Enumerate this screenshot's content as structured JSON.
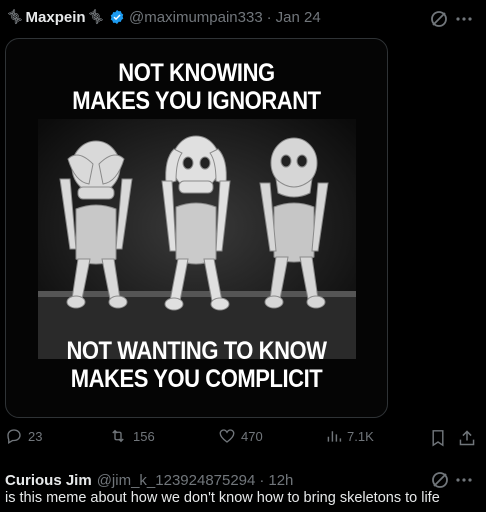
{
  "tweet": {
    "display_name": "Maxpein",
    "handle": "@maximumpain333",
    "separator": "·",
    "date": "Jan 24",
    "meme": {
      "top_line1": "NOT KNOWING",
      "top_line2": "MAKES YOU IGNORANT",
      "bottom_line1": "NOT WANTING TO KNOW",
      "bottom_line2": "MAKES YOU COMPLICIT"
    },
    "stats": {
      "replies": "23",
      "retweets": "156",
      "likes": "470",
      "views": "7.1K"
    }
  },
  "reply": {
    "display_name": "Curious Jim",
    "handle": "@jim_k_123924875294",
    "separator": "·",
    "time": "12h",
    "text": "is this meme about how we don't know how to bring skeletons to life"
  },
  "colors": {
    "background": "#000000",
    "text": "#e7e9ea",
    "muted": "#71767b",
    "verified": "#1d9bf0"
  },
  "icons": [
    "dna-icon",
    "verified-badge-icon",
    "grok-icon",
    "more-icon",
    "reply-icon",
    "retweet-icon",
    "like-icon",
    "views-icon",
    "bookmark-icon",
    "share-icon"
  ]
}
